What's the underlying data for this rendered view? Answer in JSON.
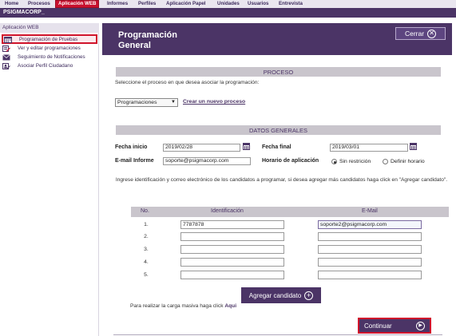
{
  "topmenu": {
    "items": [
      "Home",
      "Procesos",
      "Aplicación WEB",
      "Informes",
      "Perfiles",
      "Aplicación Papel",
      "Unidades",
      "Usuarios",
      "Entrevista"
    ],
    "active": "Aplicación WEB"
  },
  "brand": {
    "name": "PSIGMACORP_"
  },
  "sidebar": {
    "title": "Aplicación WEB",
    "items": [
      {
        "label": "Programación de Pruebas",
        "icon": "calendar-icon"
      },
      {
        "label": "Ver y editar programaciones",
        "icon": "edit-list-icon"
      },
      {
        "label": "Seguimiento de Notificaciones",
        "icon": "envelope-icon"
      },
      {
        "label": "Asociar Perfil Ciudadano",
        "icon": "user-link-icon"
      }
    ]
  },
  "header": {
    "title_line1": "Programación",
    "title_line2": "General",
    "close_label": "Cerrar"
  },
  "proceso": {
    "section_title": "PROCESO",
    "description": "Seleccione el proceso en que desea asociar la programación:",
    "selected": "Programaciones",
    "create_link": "Crear un nuevo proceso"
  },
  "datos": {
    "section_title": "DATOS GENERALES",
    "fecha_inicio_label": "Fecha inicio",
    "fecha_inicio": "2019/02/28",
    "fecha_final_label": "Fecha final",
    "fecha_final": "2019/03/01",
    "email_label": "E-mail Informe",
    "email": "soporte@psigmacorp.com",
    "horario_label": "Horario de aplicación",
    "horario_options": [
      "Sin restrición",
      "Definir horario"
    ],
    "horario_selected": "Sin restrición"
  },
  "instructions": "Ingrese identificación y correo electrónico de los candidatos a programar, si desea agregar más candidatos haga click en \"Agregar candidato\".",
  "candidates": {
    "headers": [
      "No.",
      "Identificación",
      "E-Mail"
    ],
    "rows": [
      {
        "no": "1.",
        "id": "7787878",
        "email": "soporte2@psigmacorp.com"
      },
      {
        "no": "2.",
        "id": "",
        "email": ""
      },
      {
        "no": "3.",
        "id": "",
        "email": ""
      },
      {
        "no": "4.",
        "id": "",
        "email": ""
      },
      {
        "no": "5.",
        "id": "",
        "email": ""
      }
    ]
  },
  "actions": {
    "add_candidate": "Agregar candidato",
    "bulk_text": "Para realizar la carga masiva haga click",
    "bulk_link": "Aqui",
    "continue": "Continuar"
  },
  "colors": {
    "brand": "#4b3466",
    "accent_red": "#c8102e",
    "section_gray": "#c9c5cc"
  }
}
